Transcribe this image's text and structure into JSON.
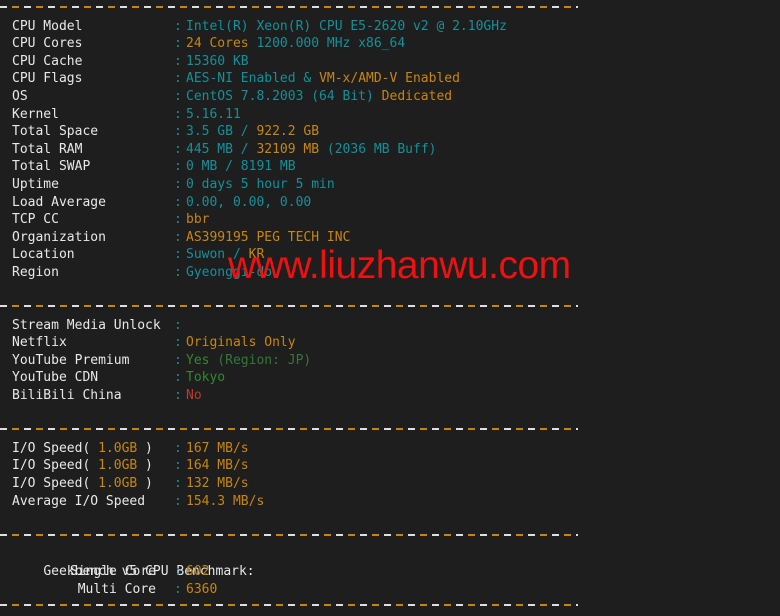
{
  "watermark": {
    "text": "www.liuzhanwu.com",
    "color": "#ee1111"
  },
  "palette": {
    "background": "#1e1e1e",
    "label": "#e8e8e8",
    "cyan": "#12919a",
    "orange": "#c8860d",
    "green": "#2d8b2d",
    "dark_green": "#36753a",
    "red": "#c0392b"
  },
  "system_info": {
    "rows": [
      {
        "key": "CPU Model",
        "parts": [
          {
            "t": "Intel(R) Xeon(R) CPU E5-2620 v2 @ 2.10GHz",
            "c": "c-cyan"
          }
        ]
      },
      {
        "key": "CPU Cores",
        "parts": [
          {
            "t": "24 Cores",
            "c": "c-orange"
          },
          {
            "t": " 1200.000 MHz x86_64",
            "c": "c-cyan"
          }
        ]
      },
      {
        "key": "CPU Cache",
        "parts": [
          {
            "t": "15360 KB",
            "c": "c-cyan"
          }
        ]
      },
      {
        "key": "CPU Flags",
        "parts": [
          {
            "t": "AES-NI Enabled",
            "c": "c-cyan"
          },
          {
            "t": " & ",
            "c": "c-cyan"
          },
          {
            "t": "VM-x/AMD-V Enabled",
            "c": "c-orange"
          }
        ]
      },
      {
        "key": "OS",
        "parts": [
          {
            "t": "CentOS 7.8.2003 (64 Bit)",
            "c": "c-cyan"
          },
          {
            "t": " ",
            "c": "c-cyan"
          },
          {
            "t": "Dedicated",
            "c": "c-orange"
          }
        ]
      },
      {
        "key": "Kernel",
        "parts": [
          {
            "t": "5.16.11",
            "c": "c-cyan"
          }
        ]
      },
      {
        "key": "Total Space",
        "parts": [
          {
            "t": "3.5 GB",
            "c": "c-cyan"
          },
          {
            "t": " / ",
            "c": "c-cyan"
          },
          {
            "t": "922.2 GB",
            "c": "c-orange"
          }
        ]
      },
      {
        "key": "Total RAM",
        "parts": [
          {
            "t": "445 MB",
            "c": "c-cyan"
          },
          {
            "t": " / ",
            "c": "c-cyan"
          },
          {
            "t": "32109 MB",
            "c": "c-orange"
          },
          {
            "t": " (2036 MB Buff)",
            "c": "c-cyan"
          }
        ]
      },
      {
        "key": "Total SWAP",
        "parts": [
          {
            "t": "0 MB / 8191 MB",
            "c": "c-cyan"
          }
        ]
      },
      {
        "key": "Uptime",
        "parts": [
          {
            "t": "0 days 5 hour 5 min",
            "c": "c-cyan"
          }
        ]
      },
      {
        "key": "Load Average",
        "parts": [
          {
            "t": "0.00, 0.00, 0.00",
            "c": "c-cyan"
          }
        ]
      },
      {
        "key": "TCP CC",
        "parts": [
          {
            "t": "bbr",
            "c": "c-orange"
          }
        ]
      },
      {
        "key": "Organization",
        "parts": [
          {
            "t": "AS399195 PEG TECH INC",
            "c": "c-orange"
          }
        ]
      },
      {
        "key": "Location",
        "parts": [
          {
            "t": "Suwon",
            "c": "c-cyan"
          },
          {
            "t": " / ",
            "c": "c-cyan"
          },
          {
            "t": "KR",
            "c": "c-orange"
          }
        ]
      },
      {
        "key": "Region",
        "parts": [
          {
            "t": "Gyeonggi-do",
            "c": "c-cyan"
          }
        ]
      }
    ]
  },
  "stream_media": {
    "rows": [
      {
        "key": "Stream Media Unlock",
        "parts": []
      },
      {
        "key": "Netflix",
        "parts": [
          {
            "t": "Originals Only",
            "c": "c-orange"
          }
        ]
      },
      {
        "key": "YouTube Premium",
        "parts": [
          {
            "t": "Yes",
            "c": "c-green"
          },
          {
            "t": " (Region: JP)",
            "c": "c-dgreen"
          }
        ]
      },
      {
        "key": "YouTube CDN",
        "parts": [
          {
            "t": "Tokyo",
            "c": "c-green"
          }
        ]
      },
      {
        "key": "BiliBili China",
        "parts": [
          {
            "t": "No",
            "c": "c-red"
          }
        ]
      }
    ]
  },
  "io_speed": {
    "rows": [
      {
        "key_parts": [
          {
            "t": "I/O Speed( ",
            "c": "c-white"
          },
          {
            "t": "1.0GB",
            "c": "c-orange"
          },
          {
            "t": " )",
            "c": "c-white"
          }
        ],
        "parts": [
          {
            "t": "167 MB/s",
            "c": "c-orange"
          }
        ]
      },
      {
        "key_parts": [
          {
            "t": "I/O Speed( ",
            "c": "c-white"
          },
          {
            "t": "1.0GB",
            "c": "c-orange"
          },
          {
            "t": " )",
            "c": "c-white"
          }
        ],
        "parts": [
          {
            "t": "164 MB/s",
            "c": "c-orange"
          }
        ]
      },
      {
        "key_parts": [
          {
            "t": "I/O Speed( ",
            "c": "c-white"
          },
          {
            "t": "1.0GB",
            "c": "c-orange"
          },
          {
            "t": " )",
            "c": "c-white"
          }
        ],
        "parts": [
          {
            "t": "132 MB/s",
            "c": "c-orange"
          }
        ]
      },
      {
        "key_parts": [
          {
            "t": "Average I/O Speed",
            "c": "c-white"
          }
        ],
        "parts": [
          {
            "t": "154.3 MB/s",
            "c": "c-orange"
          }
        ]
      }
    ]
  },
  "geekbench": {
    "heading": "Geekbench v5 CPU Benchmark:",
    "rows": [
      {
        "key": "Single Core",
        "parts": [
          {
            "t": "602",
            "c": "c-orange"
          }
        ]
      },
      {
        "key": "Multi Core",
        "parts": [
          {
            "t": "6360",
            "c": "c-orange"
          }
        ]
      }
    ]
  }
}
